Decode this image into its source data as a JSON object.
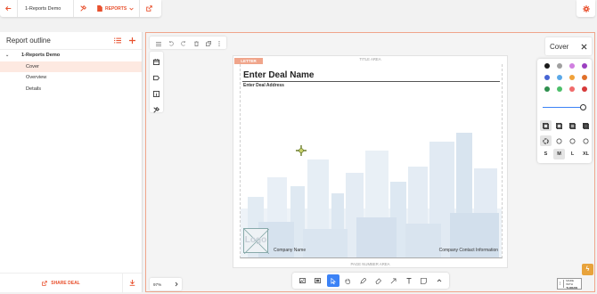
{
  "topbar": {
    "title": "1-Reports Demo",
    "reports_label": "REPORTS"
  },
  "outline": {
    "title": "Report outline",
    "root": "1-Reports Demo",
    "items": [
      {
        "label": "Cover",
        "active": true
      },
      {
        "label": "Overview",
        "active": false
      },
      {
        "label": "Details",
        "active": false
      }
    ],
    "share_label": "SHARE DEAL"
  },
  "canvas": {
    "page_label": "LETTER",
    "title_area": "TITLE AREA",
    "deal_name": "Enter Deal Name",
    "deal_address": "Enter Deal Address",
    "logo_text": "Logo",
    "company_name": "Company Name",
    "company_contact": "Company Contact Information",
    "page_number_area": "PAGE NUMBER AREA"
  },
  "zoom": {
    "value": "97%"
  },
  "made_with": {
    "line1": "MADE WITH",
    "line2": "TLDRAW"
  },
  "style_panel": {
    "title": "Cover",
    "colors": [
      "#1a1a1a",
      "#a0a0a0",
      "#d07fe0",
      "#9b3fc0",
      "#4765d4",
      "#5aa8e8",
      "#f0a23a",
      "#e0702a",
      "#2f8f4e",
      "#4cbf6a",
      "#f06b6b",
      "#d63a3a"
    ],
    "size_options": [
      "S",
      "M",
      "L",
      "XL"
    ],
    "selected_size": "M"
  },
  "accent_color": "#e8502d"
}
